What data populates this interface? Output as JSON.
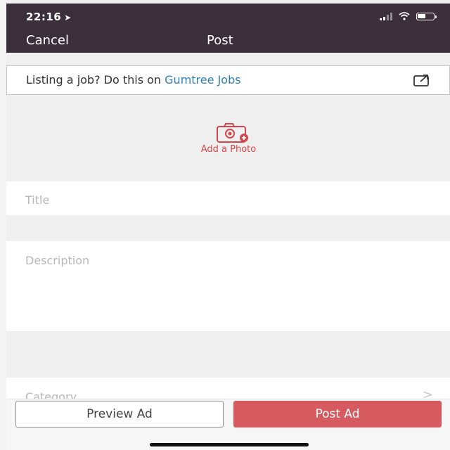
{
  "status_bar": {
    "time": "22:16",
    "location_icon": "location-arrow-icon",
    "signal_icon": "cellular-signal-icon",
    "wifi_icon": "wifi-icon",
    "battery_icon": "battery-icon"
  },
  "nav": {
    "cancel_label": "Cancel",
    "title": "Post"
  },
  "job_banner": {
    "text": "Listing a job? Do this on ",
    "link_text": "Gumtree Jobs",
    "icon": "external-link-icon"
  },
  "photo": {
    "label": "Add a Photo",
    "icon": "camera-plus-icon"
  },
  "form": {
    "title_placeholder": "Title",
    "description_placeholder": "Description",
    "category_label": "Category",
    "category_chevron": ">"
  },
  "actions": {
    "preview_label": "Preview Ad",
    "post_label": "Post Ad"
  },
  "colors": {
    "nav_bg": "#3b2f3b",
    "accent_red": "#d4474d",
    "link_blue": "#2a7fb8",
    "post_button": "#d65b61"
  }
}
